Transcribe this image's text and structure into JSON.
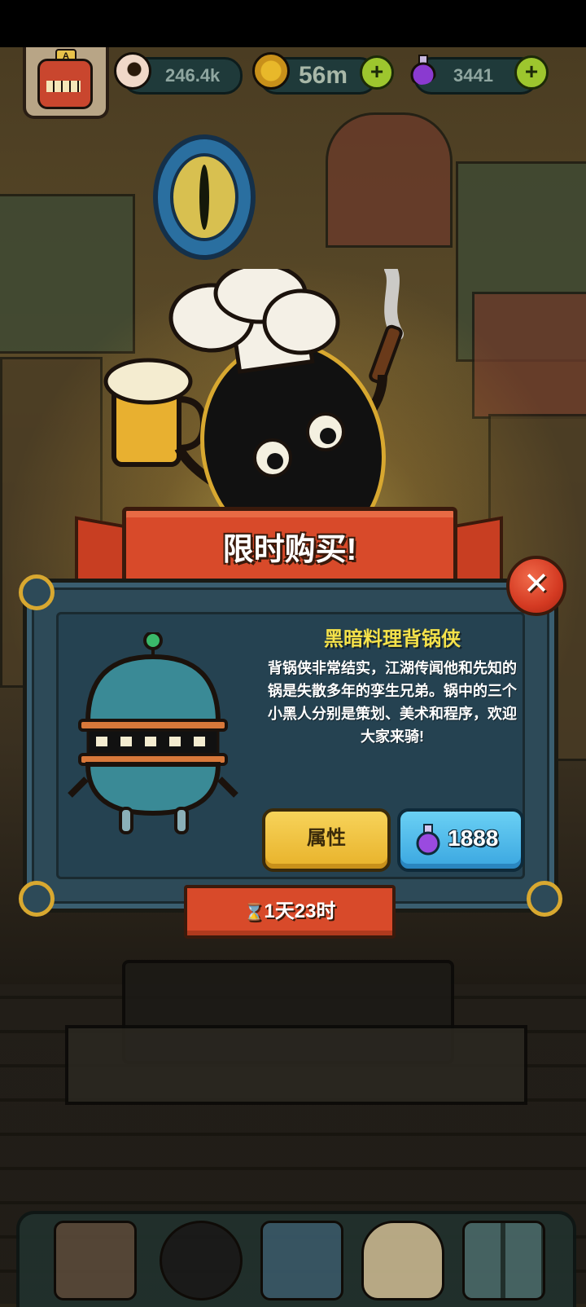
{
  "topbar": {
    "badge_letter": "A",
    "eyes_value": "246.4k",
    "coins_value": "56m",
    "potions_value": "3441"
  },
  "offer": {
    "banner_title": "限时购买!",
    "hero_name": "黑暗料理背锅侠",
    "hero_description": "背锅侠非常结实，江湖传闻他和先知的锅是失散多年的孪生兄弟。锅中的三个小黑人分别是策划、美术和程序，欢迎大家来骑!",
    "attributes_label": "属性",
    "price": "1888",
    "timer_text": "1天23时"
  },
  "icons": {
    "close": "✕",
    "hourglass": "⌛",
    "plus": "+"
  },
  "colors": {
    "banner_red": "#d84a2a",
    "panel_blue": "#2d4a58",
    "name_yellow": "#f5e24a",
    "attr_button_yellow": "#f7d35a",
    "buy_button_blue": "#3aa6e0",
    "plus_green": "#9dc62e"
  }
}
